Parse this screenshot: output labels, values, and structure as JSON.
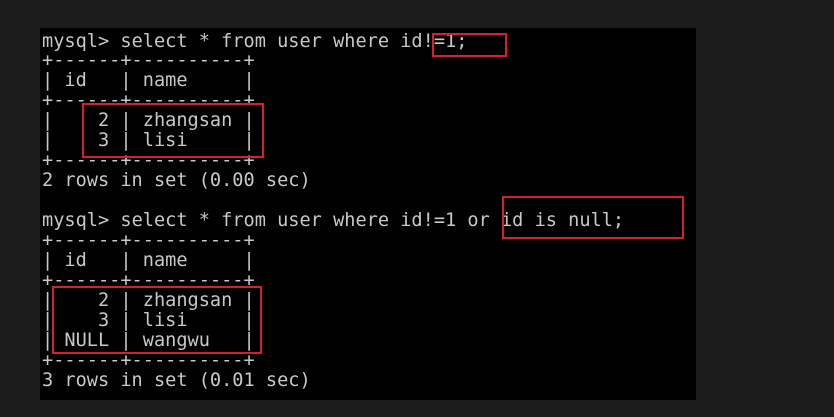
{
  "query1": {
    "prompt": "mysql>",
    "statement": "select * from user where id!=1;",
    "border_top": "+------+----------+",
    "header": "| id   | name     |",
    "border_mid": "+------+----------+",
    "rows": [
      "|    2 | zhangsan |",
      "|    3 | lisi     |"
    ],
    "border_bottom": "+------+----------+",
    "result": "2 rows in set (0.00 sec)"
  },
  "query2": {
    "prompt": "mysql>",
    "statement": "select * from user where id!=1 or id is null;",
    "border_top": "+------+----------+",
    "header": "| id   | name     |",
    "border_mid": "+------+----------+",
    "rows": [
      "|    2 | zhangsan |",
      "|    3 | lisi     |",
      "| NULL | wangwu   |"
    ],
    "border_bottom": "+------+----------+",
    "result": "3 rows in set (0.01 sec)"
  },
  "colors": {
    "terminal_bg": "#000000",
    "text": "#c8c8c8",
    "highlight_box": "#d3212d",
    "page_bg": "#1b1b1b"
  }
}
